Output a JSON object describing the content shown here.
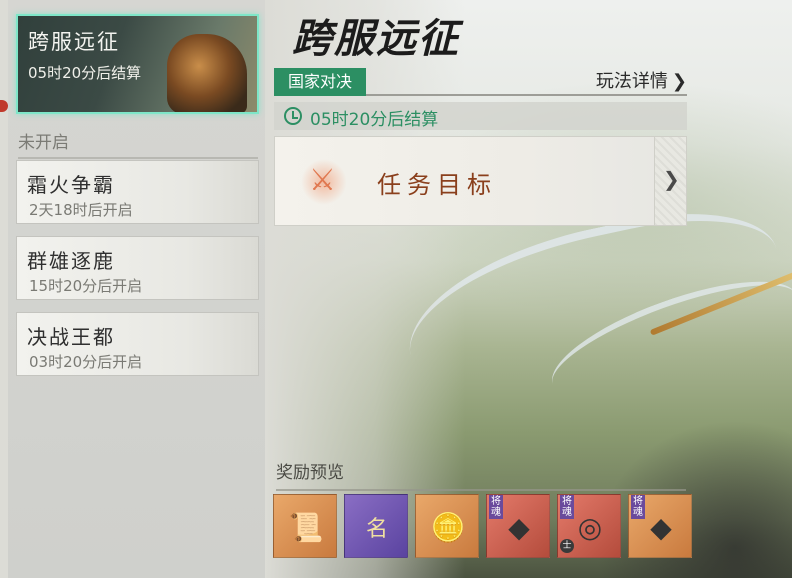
{
  "active_event": {
    "title": "跨服远征",
    "time": "05时20分后结算"
  },
  "upcoming_section_label": "未开启",
  "upcoming": [
    {
      "name": "霜火争霸",
      "time": "2天18时后开启"
    },
    {
      "name": "群雄逐鹿",
      "time": "15时20分后开启"
    },
    {
      "name": "决战王都",
      "time": "03时20分后开启"
    }
  ],
  "header": {
    "title": "跨服远征",
    "tag": "国家对决",
    "rules_link": "玩法详情"
  },
  "timer": "05时20分后结算",
  "task": {
    "label": "任务目标"
  },
  "rewards": {
    "label": "奖励预览",
    "items": [
      {
        "icon": "scroll-icon",
        "rarity": "orange"
      },
      {
        "icon": "name-seal-icon",
        "rarity": "purple",
        "mark": "名"
      },
      {
        "icon": "gold-ingot-icon",
        "rarity": "orange"
      },
      {
        "icon": "general-soul-chest-icon",
        "rarity": "red",
        "badge": "将魂"
      },
      {
        "icon": "general-soul-orb-icon",
        "rarity": "red",
        "badge": "将魂",
        "corner": "士"
      },
      {
        "icon": "general-soul-chest-icon",
        "rarity": "orange",
        "badge": "将魂"
      }
    ]
  },
  "colors": {
    "accent_green": "#2c8f63",
    "active_border": "#7ee6c8",
    "task_text": "#8a3f1c"
  }
}
